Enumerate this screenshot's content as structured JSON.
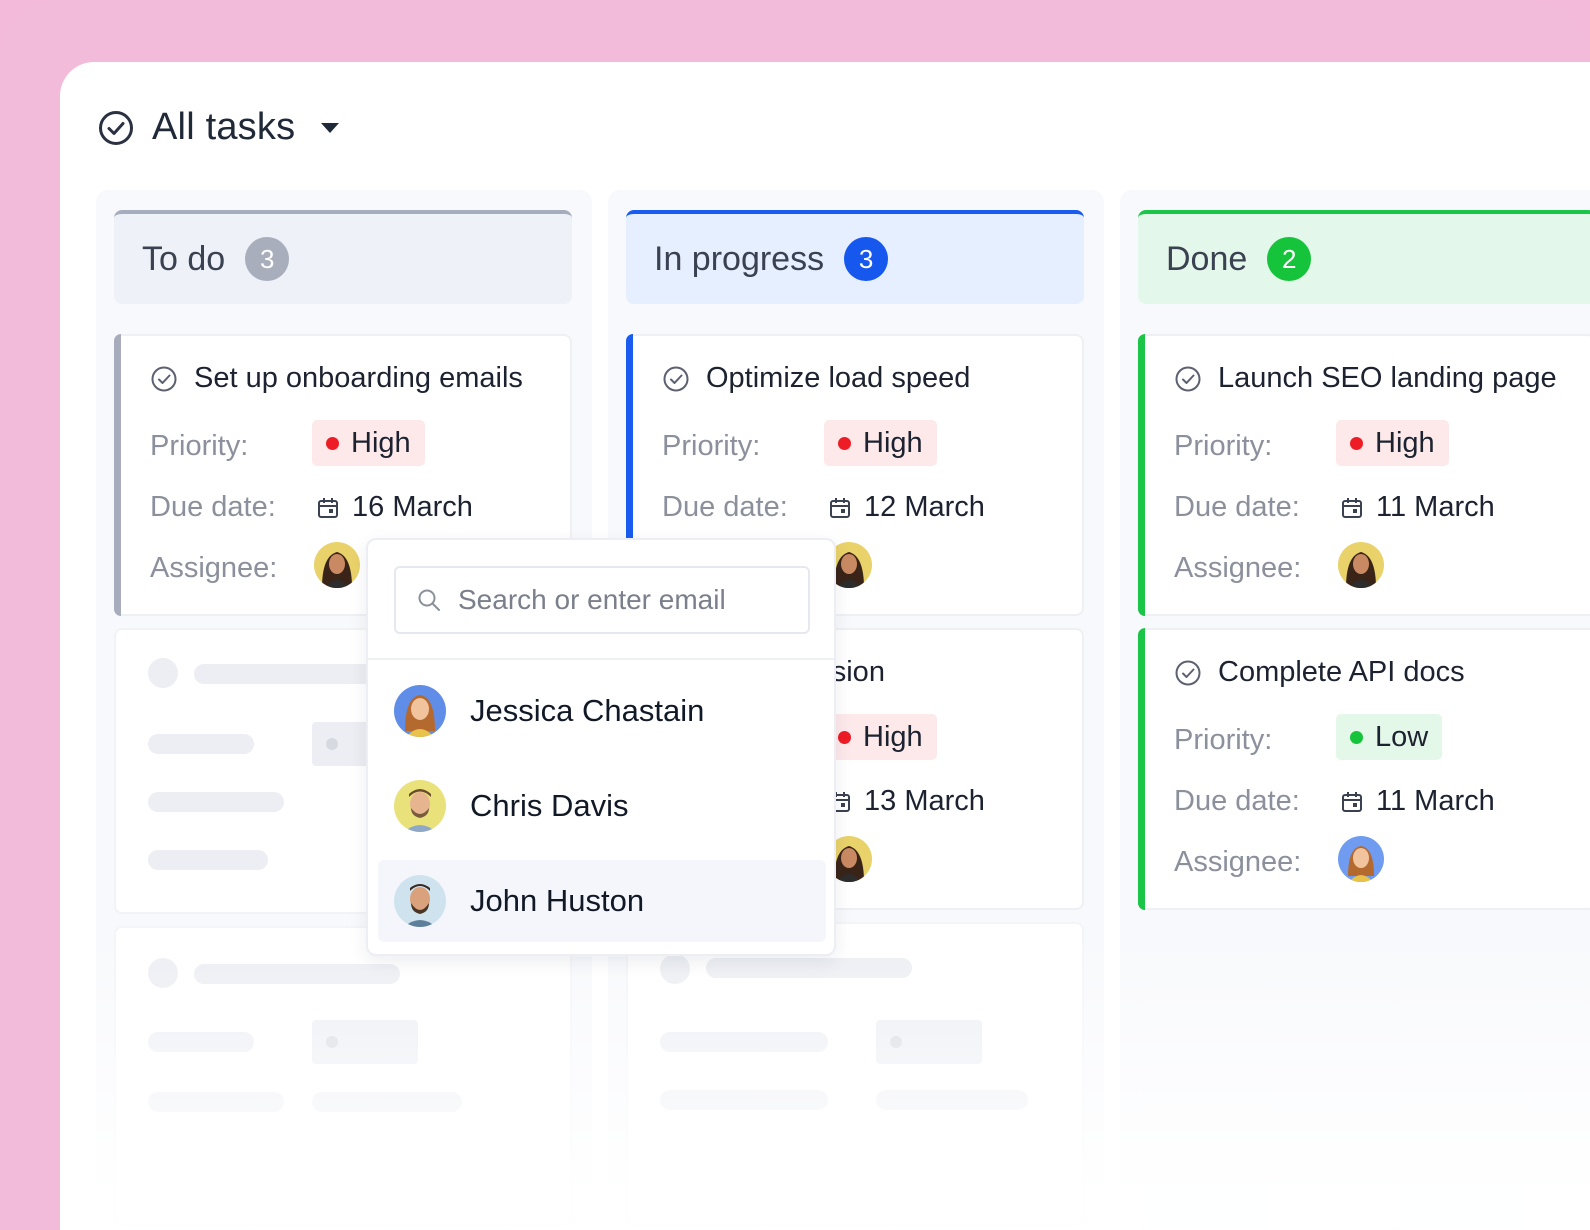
{
  "header": {
    "title": "All tasks"
  },
  "labels": {
    "priority": "Priority:",
    "due": "Due date:",
    "assignee": "Assignee:"
  },
  "columns": [
    {
      "name": "To do",
      "count": "3",
      "accent": "#a7adbd"
    },
    {
      "name": "In progress",
      "count": "3",
      "accent": "#1a5cf0"
    },
    {
      "name": "Done",
      "count": "2",
      "accent": "#1bc547"
    }
  ],
  "cards": {
    "todo_1": {
      "title": "Set up onboarding emails",
      "priority": "High",
      "due": "16 March"
    },
    "prog_1": {
      "title": "Optimize load speed",
      "priority": "High",
      "due": "12 March"
    },
    "prog_2": {
      "title": "nobile version",
      "priority": "High",
      "due": "13 March"
    },
    "done_1": {
      "title": "Launch SEO landing page",
      "priority": "High",
      "due": "11 March"
    },
    "done_2": {
      "title": "Complete API docs",
      "priority": "Low",
      "due": "11 March"
    }
  },
  "assignee_dropdown": {
    "search_placeholder": "Search or enter email",
    "people": [
      "Jessica Chastain",
      "Chris Davis",
      "John Huston"
    ]
  },
  "colors": {
    "high": "#ee1c25",
    "low": "#16c43b",
    "background": "#f2bbd9"
  }
}
